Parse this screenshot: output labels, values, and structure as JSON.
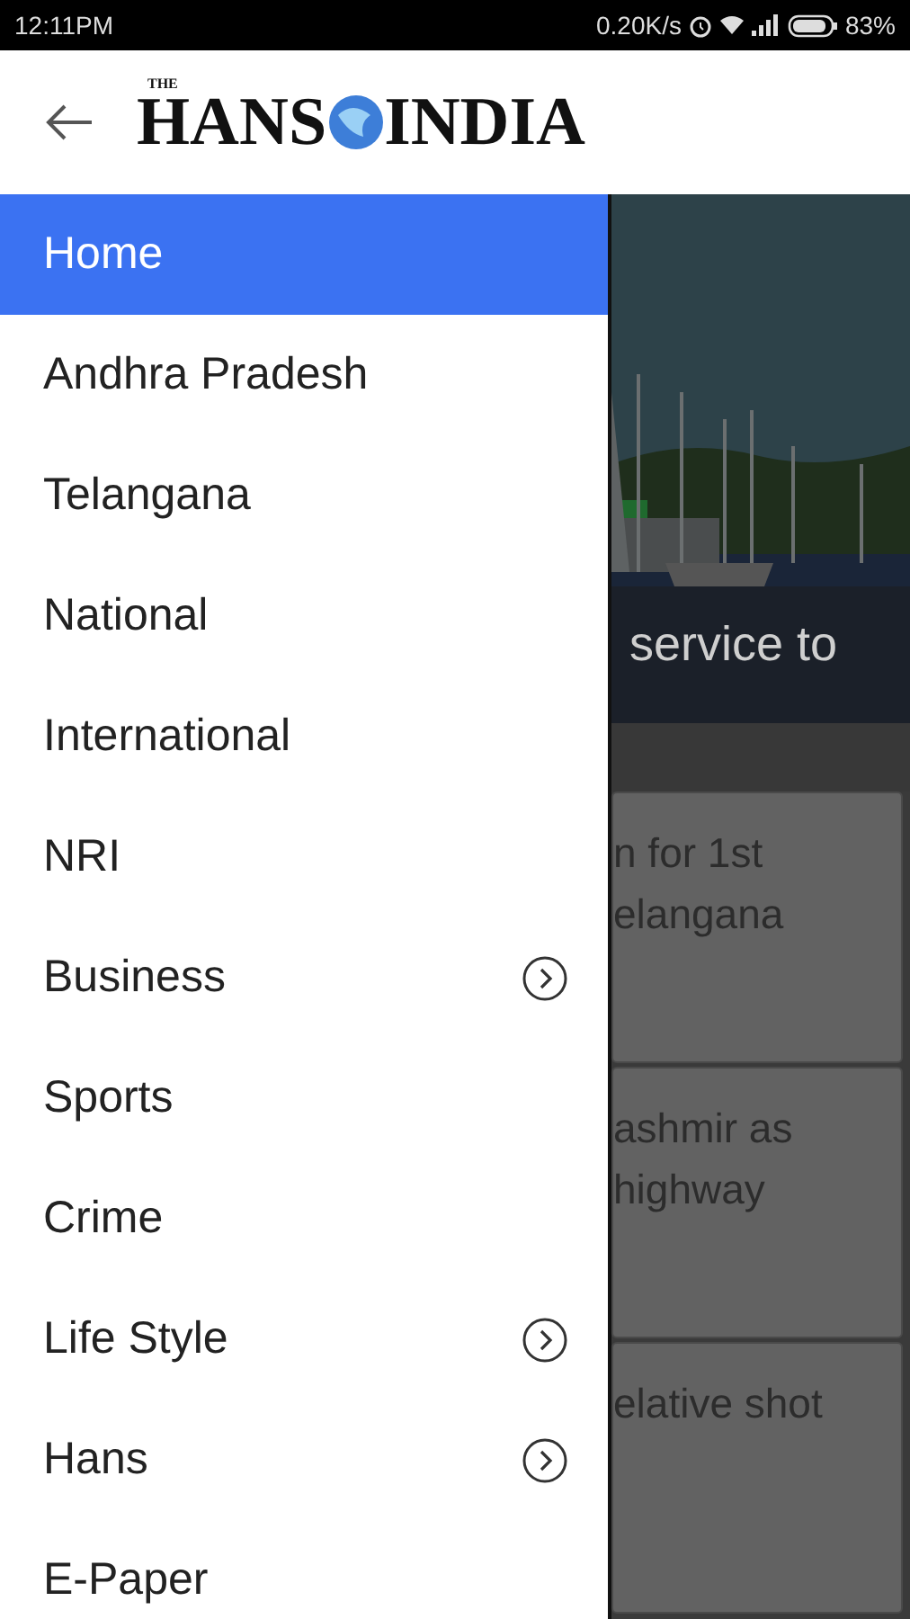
{
  "status_bar": {
    "time": "12:11PM",
    "speed": "0.20K/s",
    "battery": "83%"
  },
  "header": {
    "logo": {
      "small": "THE",
      "left": "HANS",
      "right": "INDIA"
    }
  },
  "drawer": {
    "items": [
      {
        "label": "Home",
        "selected": true,
        "expandable": false
      },
      {
        "label": "Andhra Pradesh",
        "selected": false,
        "expandable": false
      },
      {
        "label": "Telangana",
        "selected": false,
        "expandable": false
      },
      {
        "label": "National",
        "selected": false,
        "expandable": false
      },
      {
        "label": "International",
        "selected": false,
        "expandable": false
      },
      {
        "label": "NRI",
        "selected": false,
        "expandable": false
      },
      {
        "label": "Business",
        "selected": false,
        "expandable": true
      },
      {
        "label": "Sports",
        "selected": false,
        "expandable": false
      },
      {
        "label": "Crime",
        "selected": false,
        "expandable": false
      },
      {
        "label": "Life Style",
        "selected": false,
        "expandable": true
      },
      {
        "label": "Hans",
        "selected": false,
        "expandable": true
      },
      {
        "label": "E-Paper",
        "selected": false,
        "expandable": false
      }
    ]
  },
  "content": {
    "featured": {
      "kind": "picture",
      "caption": "service to"
    },
    "cards": [
      {
        "lines": [
          "n for 1st",
          "elangana"
        ]
      },
      {
        "lines": [
          "ashmir as",
          "highway"
        ]
      },
      {
        "lines": [
          "elative shot"
        ]
      }
    ]
  }
}
